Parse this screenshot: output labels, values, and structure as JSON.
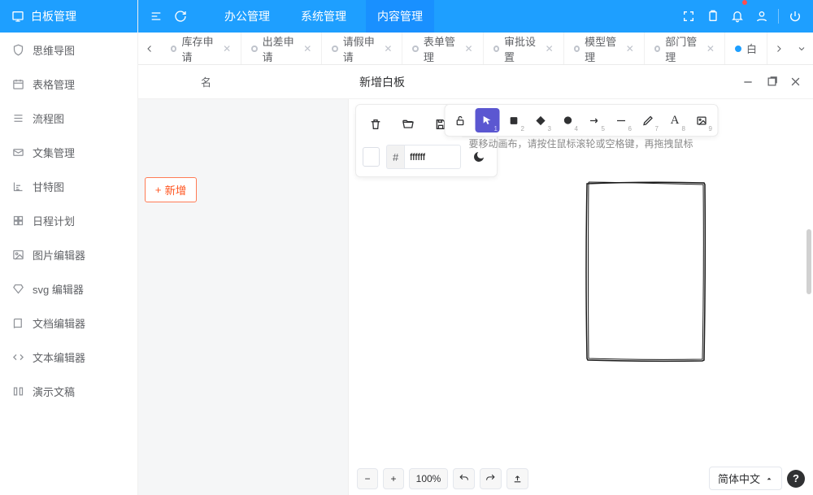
{
  "sidebar": {
    "title": "白板管理",
    "items": [
      {
        "label": "思维导图"
      },
      {
        "label": "表格管理"
      },
      {
        "label": "流程图"
      },
      {
        "label": "文集管理"
      },
      {
        "label": "甘特图"
      },
      {
        "label": "日程计划"
      },
      {
        "label": "图片编辑器"
      },
      {
        "label": "svg 编辑器"
      },
      {
        "label": "文档编辑器"
      },
      {
        "label": "文本编辑器"
      },
      {
        "label": "演示文稿"
      }
    ]
  },
  "topnav": {
    "tabs": [
      {
        "label": "办公管理"
      },
      {
        "label": "系统管理"
      },
      {
        "label": "内容管理",
        "active": true
      }
    ]
  },
  "filetabs": [
    {
      "label": "库存申请"
    },
    {
      "label": "出差申请"
    },
    {
      "label": "请假申请"
    },
    {
      "label": "表单管理"
    },
    {
      "label": "审批设置"
    },
    {
      "label": "模型管理"
    },
    {
      "label": "部门管理"
    },
    {
      "label": "白",
      "active": true
    }
  ],
  "underPanel": {
    "col_label": "名",
    "add_button": "新增"
  },
  "editor": {
    "title": "新增白板",
    "hex_prefix": "#",
    "hex_value": "ffffff",
    "hint": "要移动画布，请按住鼠标滚轮或空格键，再拖拽鼠标",
    "zoom": "100%",
    "language": "简体中文"
  }
}
